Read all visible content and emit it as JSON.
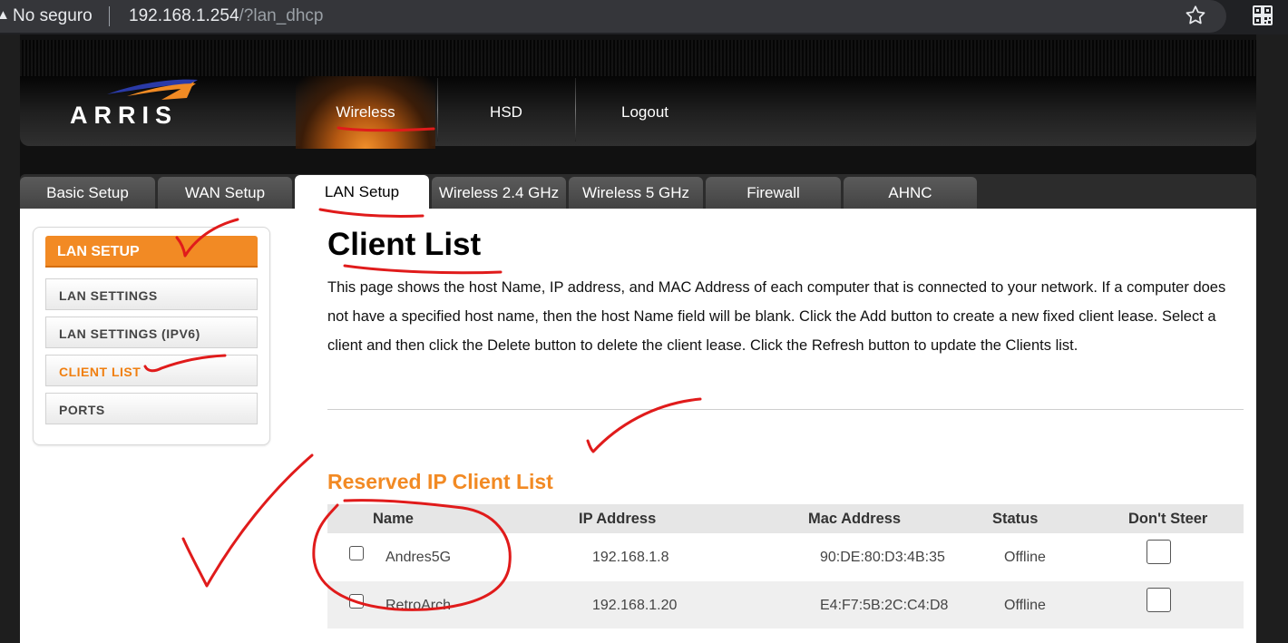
{
  "browser": {
    "security_label": "No seguro",
    "url_host": "192.168.1.254",
    "url_path": "/?lan_dhcp"
  },
  "header": {
    "logo_text": "ARRIS",
    "nav": [
      "Wireless",
      "HSD",
      "Logout"
    ],
    "active_nav": "Wireless"
  },
  "tabs": [
    "Basic Setup",
    "WAN Setup",
    "LAN Setup",
    "Wireless 2.4 GHz",
    "Wireless 5 GHz",
    "Firewall",
    "AHNC"
  ],
  "active_tab": "LAN Setup",
  "sidebar": {
    "title": "LAN SETUP",
    "items": [
      "LAN SETTINGS",
      "LAN SETTINGS (IPV6)",
      "CLIENT LIST",
      "PORTS"
    ],
    "active_item": "CLIENT LIST"
  },
  "main": {
    "title": "Client List",
    "description": "This page shows the host Name, IP address, and MAC Address of each computer that is connected to your network. If a computer does not have a specified host name, then the host Name field will be blank. Click the Add button to create a new fixed client lease. Select a client and then click the Delete button to delete the client lease. Click the Refresh button to update the Clients list.",
    "section_title": "Reserved IP Client List"
  },
  "table": {
    "columns": [
      "Name",
      "IP Address",
      "Mac Address",
      "Status",
      "Don't Steer"
    ],
    "rows": [
      {
        "name": "Andres5G",
        "ip": "192.168.1.8",
        "mac": "90:DE:80:D3:4B:35",
        "status": "Offline",
        "selected": false,
        "dont_steer": false
      },
      {
        "name": "RetroArch",
        "ip": "192.168.1.20",
        "mac": "E4:F7:5B:2C:C4:D8",
        "status": "Offline",
        "selected": false,
        "dont_steer": false
      }
    ]
  },
  "colors": {
    "accent_orange": "#f28a24",
    "annotation_red": "#e01b1b"
  }
}
